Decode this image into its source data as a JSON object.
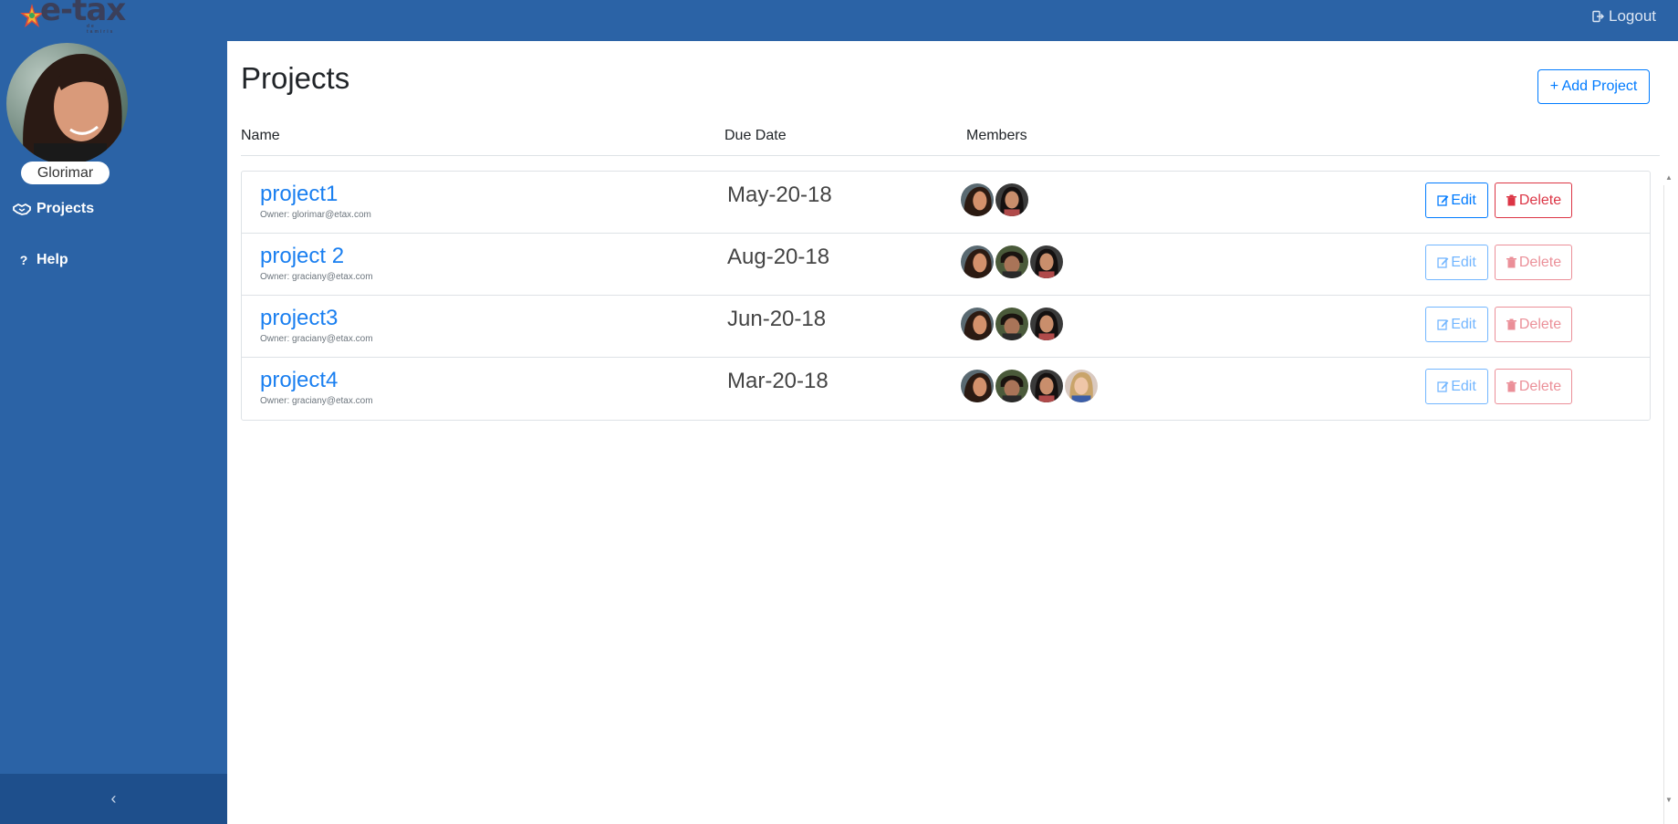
{
  "header": {
    "logo_text": "e-tax",
    "logo_sub": "de tamiris",
    "logout_label": "Logout"
  },
  "sidebar": {
    "username": "Glorimar",
    "items": [
      {
        "label": "Projects",
        "icon": "handshake-icon"
      },
      {
        "label": "Help",
        "icon": "question-icon"
      }
    ],
    "collapse_label": "‹"
  },
  "main": {
    "title": "Projects",
    "add_button_label": "+ Add Project",
    "columns": [
      "Name",
      "Due Date",
      "Members"
    ],
    "projects": [
      {
        "name": "project1",
        "owner": "Owner: glorimar@etax.com",
        "due": "May-20-18",
        "members": [
          "member-a",
          "member-b"
        ],
        "edit_label": "Edit",
        "delete_label": "Delete",
        "enabled": true
      },
      {
        "name": "project 2",
        "owner": "Owner: graciany@etax.com",
        "due": "Aug-20-18",
        "members": [
          "member-a",
          "member-c",
          "member-b"
        ],
        "edit_label": "Edit",
        "delete_label": "Delete",
        "enabled": false
      },
      {
        "name": "project3",
        "owner": "Owner: graciany@etax.com",
        "due": "Jun-20-18",
        "members": [
          "member-a",
          "member-c",
          "member-b"
        ],
        "edit_label": "Edit",
        "delete_label": "Delete",
        "enabled": false
      },
      {
        "name": "project4",
        "owner": "Owner: graciany@etax.com",
        "due": "Mar-20-18",
        "members": [
          "member-a",
          "member-c",
          "member-b",
          "member-d"
        ],
        "edit_label": "Edit",
        "delete_label": "Delete",
        "enabled": false
      }
    ]
  },
  "colors": {
    "brand_blue": "#2b63a6",
    "sidebar_footer": "#1e4f8c",
    "primary": "#007bff",
    "danger": "#dc3545",
    "link": "#1a7ff0"
  }
}
